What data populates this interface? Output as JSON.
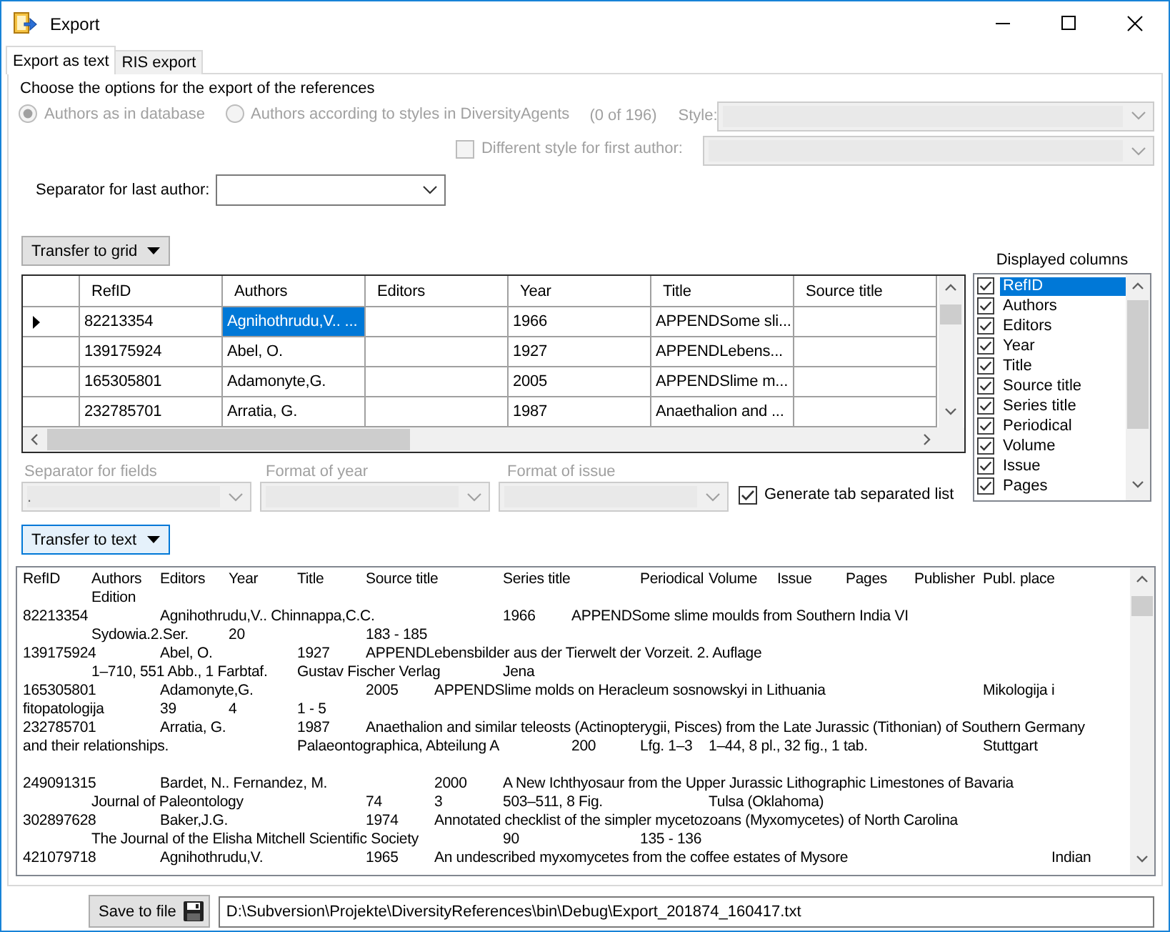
{
  "window": {
    "title": "Export"
  },
  "tabs": [
    {
      "label": "Export as text",
      "selected": true
    },
    {
      "label": "RIS export",
      "selected": false
    }
  ],
  "intro": "Choose the options for the export of the references",
  "author_options": [
    {
      "label": "Authors as in database",
      "selected": true,
      "disabled": true
    },
    {
      "label": "Authors according to styles in DiversityAgents",
      "selected": false,
      "disabled": true
    }
  ],
  "agent_count": "(0 of 196)",
  "style": {
    "label": "Style:",
    "disabled": true
  },
  "first_author_style": {
    "label": "Different style for first author:",
    "checked": false,
    "disabled": true
  },
  "last_author_separator": {
    "label": "Separator for last author:",
    "disabled": false
  },
  "transfer_to_grid": {
    "label": "Transfer to grid"
  },
  "grid": {
    "columns": [
      "RefID",
      "Authors",
      "Editors",
      "Year",
      "Title",
      "Source title"
    ],
    "rows": [
      {
        "current": true,
        "cells": [
          {
            "text": "82213354",
            "selected": false
          },
          {
            "text": "Agnihothrudu,V.. ...",
            "selected": true
          },
          {
            "selected": false
          },
          {
            "text": "1966",
            "selected": false
          },
          {
            "text": "APPENDSome sli...",
            "selected": false
          },
          {
            "selected": false
          }
        ]
      },
      {
        "current": false,
        "cells": [
          {
            "text": "139175924",
            "selected": false
          },
          {
            "text": "Abel, O.",
            "selected": false
          },
          {
            "selected": false
          },
          {
            "text": "1927",
            "selected": false
          },
          {
            "text": "APPENDLebens...",
            "selected": false
          },
          {
            "selected": false
          }
        ]
      },
      {
        "current": false,
        "cells": [
          {
            "text": "165305801",
            "selected": false
          },
          {
            "text": "Adamonyte,G.",
            "selected": false
          },
          {
            "selected": false
          },
          {
            "text": "2005",
            "selected": false
          },
          {
            "text": "APPENDSlime m...",
            "selected": false
          },
          {
            "selected": false
          }
        ]
      },
      {
        "current": false,
        "cells": [
          {
            "text": "232785701",
            "selected": false
          },
          {
            "text": "Arratia, G.",
            "selected": false
          },
          {
            "selected": false
          },
          {
            "text": "1987",
            "selected": false
          },
          {
            "text": "Anaethalion and ...",
            "selected": false
          },
          {
            "selected": false
          }
        ]
      }
    ]
  },
  "displayed_columns": {
    "label": "Displayed columns",
    "items": [
      {
        "label": "RefID",
        "checked": true,
        "selected": true
      },
      {
        "label": "Authors",
        "checked": true,
        "selected": false
      },
      {
        "label": "Editors",
        "checked": true,
        "selected": false
      },
      {
        "label": "Year",
        "checked": true,
        "selected": false
      },
      {
        "label": "Title",
        "checked": true,
        "selected": false
      },
      {
        "label": "Source title",
        "checked": true,
        "selected": false
      },
      {
        "label": "Series title",
        "checked": true,
        "selected": false
      },
      {
        "label": "Periodical",
        "checked": true,
        "selected": false
      },
      {
        "label": "Volume",
        "checked": true,
        "selected": false
      },
      {
        "label": "Issue",
        "checked": true,
        "selected": false
      },
      {
        "label": "Pages",
        "checked": true,
        "selected": false
      }
    ]
  },
  "field_options": [
    {
      "label": "Separator for fields",
      "value": ".",
      "disabled": true
    },
    {
      "label": "Format of year",
      "disabled": true
    },
    {
      "label": "Format of issue",
      "disabled": true
    }
  ],
  "tab_separated": {
    "label": "Generate tab separated list",
    "checked": true,
    "disabled": false
  },
  "transfer_to_text": {
    "label": "Transfer to text"
  },
  "export_text": "RefID\tAuthors\tEditors\tYear\tTitle\tSource title\tSeries title\tPeriodical\tVolume\tIssue\tPages\tPublisher\tPubl. place\n\tEdition\n82213354\t\tAgnihothrudu,V.. Chinnappa,C.C.\t\t1966\tAPPENDSome slime moulds from Southern India VI\n\tSydowia.2.Ser.\t20\t\t183 - 185\n139175924\tAbel, O.\t\t1927\tAPPENDLebensbilder aus der Tierwelt der Vorzeit. 2. Auflage\n\t1–710, 551 Abb., 1 Farbtaf.\tGustav Fischer Verlag\tJena\n165305801\tAdamonyte,G.\t\t2005\tAPPENDSlime molds on Heracleum sosnowskyi in Lithuania\t\t\tMikologija i\nfitopatologija\t39\t4\t1 - 5\n232785701\tArratia, G.\t\t1987\tAnaethalion and similar teleosts (Actinopterygii, Pisces) from the Late Jurassic (Tithonian) of Southern Germany\nand their relationships.\t\tPalaeontographica, Abteilung A\t\t200\tLfg. 1–3\t1–44, 8 pl., 32 fig., 1 tab.\t\tStuttgart\n\n249091315\tBardet, N.. Fernandez, M.\t\t2000\tA New Ichthyosaur from the Upper Jurassic Lithographic Limestones of Bavaria\n\tJournal of Paleontology\t\t74\t3\t503–511, 8 Fig.\t\tTulsa (Oklahoma)\n302897628\tBaker,J.G.\t\t1974\tAnnotated checklist of the simpler mycetozoans (Myxomycetes) of North Carolina\n\tThe Journal of the Elisha Mitchell Scientific Society\t\t90\t\t135 - 136\n421079718\tAgnihothrudu,V.\t\t1965\tAn undescribed myxomycetes from the coffee estates of Mysore\t\t\tIndian",
  "save": {
    "label": "Save to file"
  },
  "file_path": "D:\\Subversion\\Projekte\\DiversityReferences\\bin\\Debug\\Export_201874_160417.txt"
}
